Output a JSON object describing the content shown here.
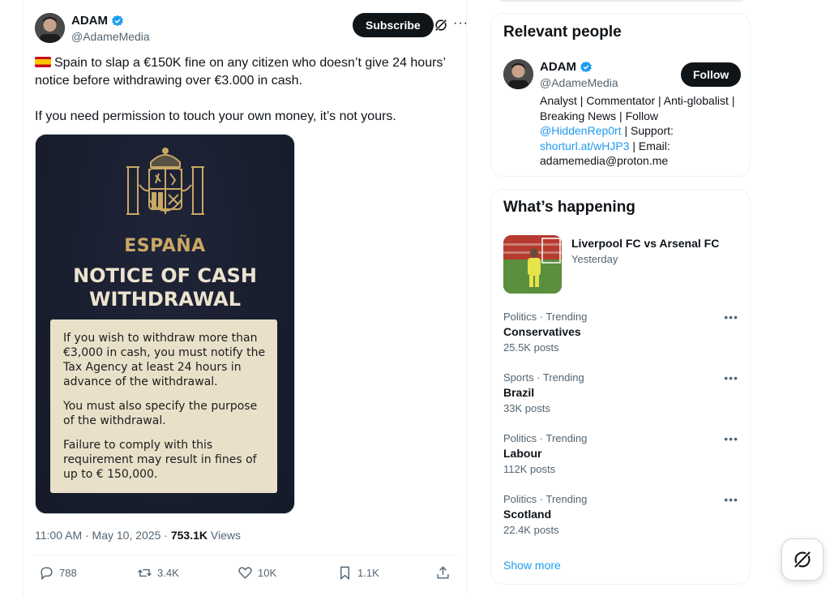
{
  "tweet": {
    "author_name": "ADAM",
    "author_handle": "@AdameMedia",
    "subscribe_label": "Subscribe",
    "more_label": "···",
    "text_line1": "Spain to slap a €150K fine on any citizen who doesn’t give 24 hours’ notice before withdrawing over €3.000 in cash.",
    "text_line2": "If you need permission to touch your own money, it’s not yours.",
    "image": {
      "country": "ESPAÑA",
      "title_line1": "NOTICE OF CASH",
      "title_line2": "WITHDRAWAL",
      "para1": "If you wish to withdraw more than €3,000 in cash, you must notify the Tax Agency at least 24 hours in advance of the withdrawal.",
      "para2": "You must also specify the purpose of the withdrawal.",
      "para3": "Failure to comply with this requirement may result in fines of up to € 150,000."
    },
    "timestamp": "11:00 AM · May 10, 2025 · ",
    "views_count": "753.1K",
    "views_label": " Views",
    "replies": "788",
    "reposts": "3.4K",
    "likes": "10K",
    "bookmarks": "1.1K"
  },
  "relevant_people": {
    "title": "Relevant people",
    "name": "ADAM",
    "handle": "@AdameMedia",
    "follow_label": "Follow",
    "bio_part1": "Analyst | Commentator | Anti-globalist | Breaking News | Follow ",
    "bio_link1": "@HiddenRep0rt",
    "bio_part2": " | Support: ",
    "bio_link2": "shorturl.at/wHJP3",
    "bio_part3": " | Email: adamemedia@proton.me"
  },
  "whats_happening": {
    "title": "What’s happening",
    "news_title": "Liverpool FC vs Arsenal FC",
    "news_time": "Yesterday",
    "trends": [
      {
        "category": "Politics · Trending",
        "name": "Conservatives",
        "posts": "25.5K posts"
      },
      {
        "category": "Sports · Trending",
        "name": "Brazil",
        "posts": "33K posts"
      },
      {
        "category": "Politics · Trending",
        "name": "Labour",
        "posts": "112K posts"
      },
      {
        "category": "Politics · Trending",
        "name": "Scotland",
        "posts": "22.4K posts"
      }
    ],
    "show_more": "Show more"
  },
  "colors": {
    "accent": "#1d9bf0",
    "text_primary": "#0f1419",
    "text_secondary": "#536471",
    "gold": "#c9a864"
  },
  "icons": [
    "verified-badge-icon",
    "grok-icon",
    "more-icon",
    "reply-icon",
    "repost-icon",
    "like-icon",
    "bookmark-icon",
    "share-icon",
    "spain-flag-icon"
  ]
}
